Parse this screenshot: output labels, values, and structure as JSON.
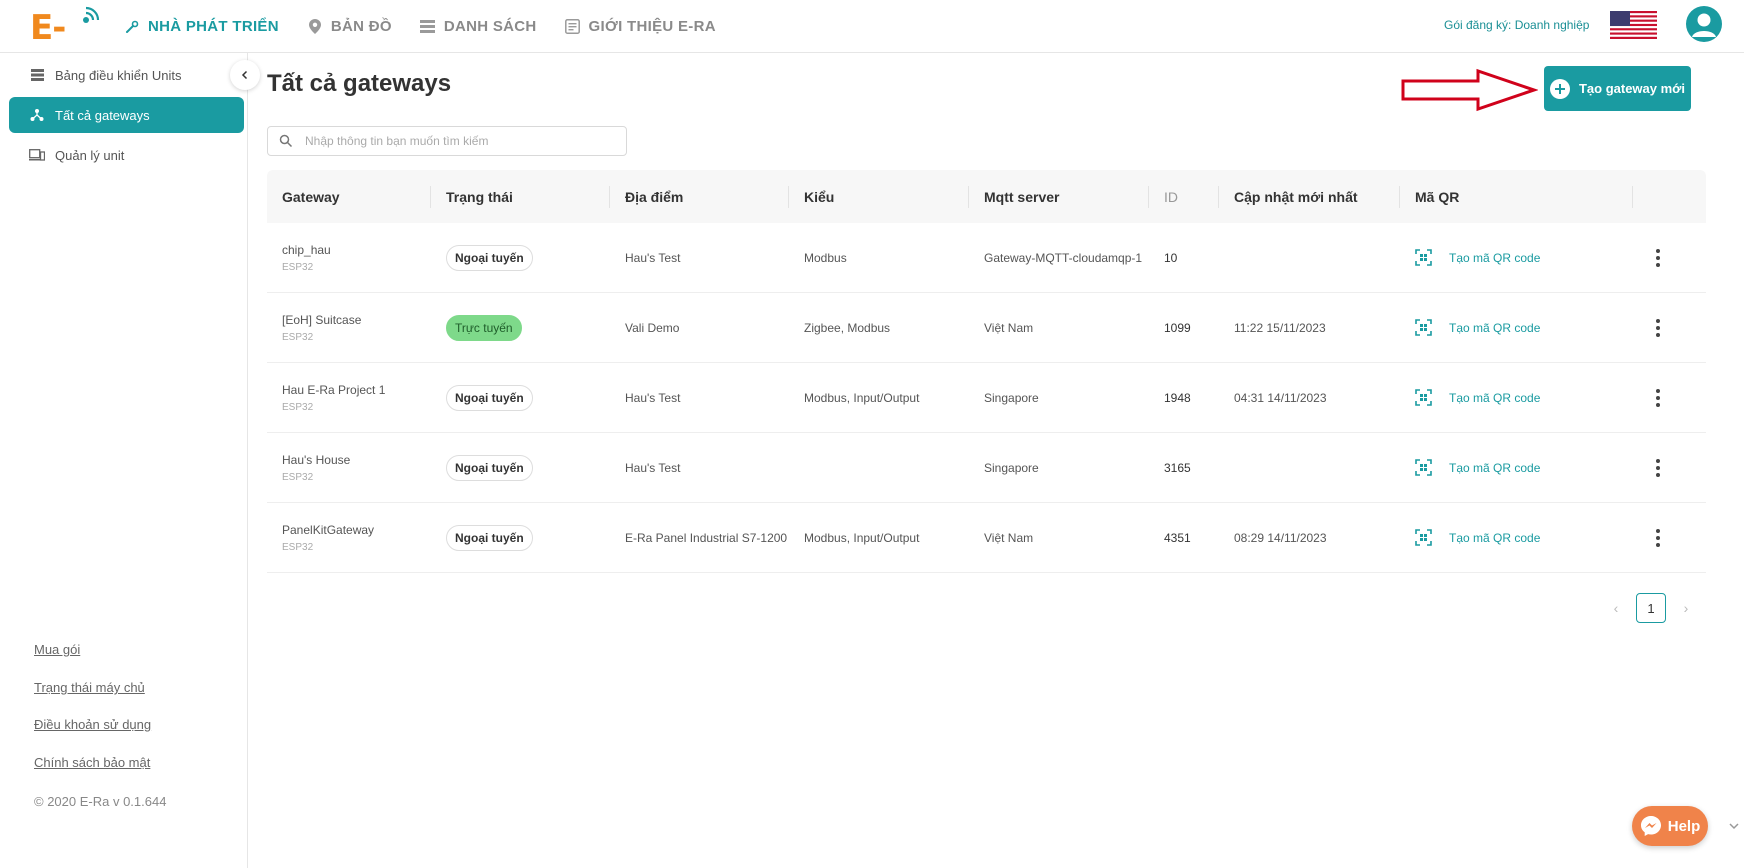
{
  "brand": {
    "logo_text": "E-Ra",
    "accent": "#1a9ba1",
    "logo_color": "#f0891e"
  },
  "nav": [
    {
      "label": "NHÀ PHÁT TRIỂN",
      "icon": "wrench-icon",
      "active": true
    },
    {
      "label": "BẢN ĐỒ",
      "icon": "map-pin-icon",
      "active": false
    },
    {
      "label": "DANH SÁCH",
      "icon": "list-icon",
      "active": false
    },
    {
      "label": "GIỚI THIỆU E-RA",
      "icon": "info-page-icon",
      "active": false
    }
  ],
  "header": {
    "plan": "Gói đăng ký: Doanh nghiệp",
    "flag": "us-flag-icon",
    "avatar": "user-avatar-icon"
  },
  "sidebar": {
    "items": [
      {
        "label": "Bảng điều khiển Units",
        "icon": "dashboard-icon",
        "active": false
      },
      {
        "label": "Tất cả gateways",
        "icon": "gateway-icon",
        "active": true
      },
      {
        "label": "Quản lý unit",
        "icon": "devices-icon",
        "active": false
      }
    ],
    "footer_links": [
      "Mua gói",
      "Trạng thái máy chủ",
      "Điều khoản sử dụng",
      "Chính sách bảo mật"
    ],
    "copyright": "© 2020 E-Ra v 0.1.644"
  },
  "main": {
    "title": "Tất cả gateways",
    "search_placeholder": "Nhập thông tin bạn muốn tìm kiếm",
    "create_button": "Tạo gateway mới"
  },
  "table": {
    "columns": [
      "Gateway",
      "Trạng thái",
      "Địa điểm",
      "Kiểu",
      "Mqtt server",
      "ID",
      "Cập nhật mới nhất",
      "Mã QR"
    ],
    "qr_label": "Tạo mã QR code",
    "rows": [
      {
        "name": "chip_hau",
        "board": "ESP32",
        "status": "Ngoại tuyến",
        "online": false,
        "location": "Hau's Test",
        "type": "Modbus",
        "mqtt": "Gateway-MQTT-cloudamqp-1",
        "id": "10",
        "updated": ""
      },
      {
        "name": "[EoH] Suitcase",
        "board": "ESP32",
        "status": "Trực tuyến",
        "online": true,
        "location": "Vali Demo",
        "type": "Zigbee, Modbus",
        "mqtt": "Việt Nam",
        "id": "1099",
        "updated": "11:22 15/11/2023"
      },
      {
        "name": "Hau E-Ra Project 1",
        "board": "ESP32",
        "status": "Ngoại tuyến",
        "online": false,
        "location": "Hau's Test",
        "type": "Modbus, Input/Output",
        "mqtt": "Singapore",
        "id": "1948",
        "updated": "04:31 14/11/2023"
      },
      {
        "name": "Hau's House",
        "board": "ESP32",
        "status": "Ngoại tuyến",
        "online": false,
        "location": "Hau's Test",
        "type": "",
        "mqtt": "Singapore",
        "id": "3165",
        "updated": ""
      },
      {
        "name": "PanelKitGateway",
        "board": "ESP32",
        "status": "Ngoại tuyến",
        "online": false,
        "location": "E-Ra Panel Industrial S7-1200",
        "type": "Modbus, Input/Output",
        "mqtt": "Việt Nam",
        "id": "4351",
        "updated": "08:29 14/11/2023"
      }
    ]
  },
  "pagination": {
    "current": "1",
    "prev": "‹",
    "next": "›"
  },
  "help": {
    "label": "Help"
  }
}
